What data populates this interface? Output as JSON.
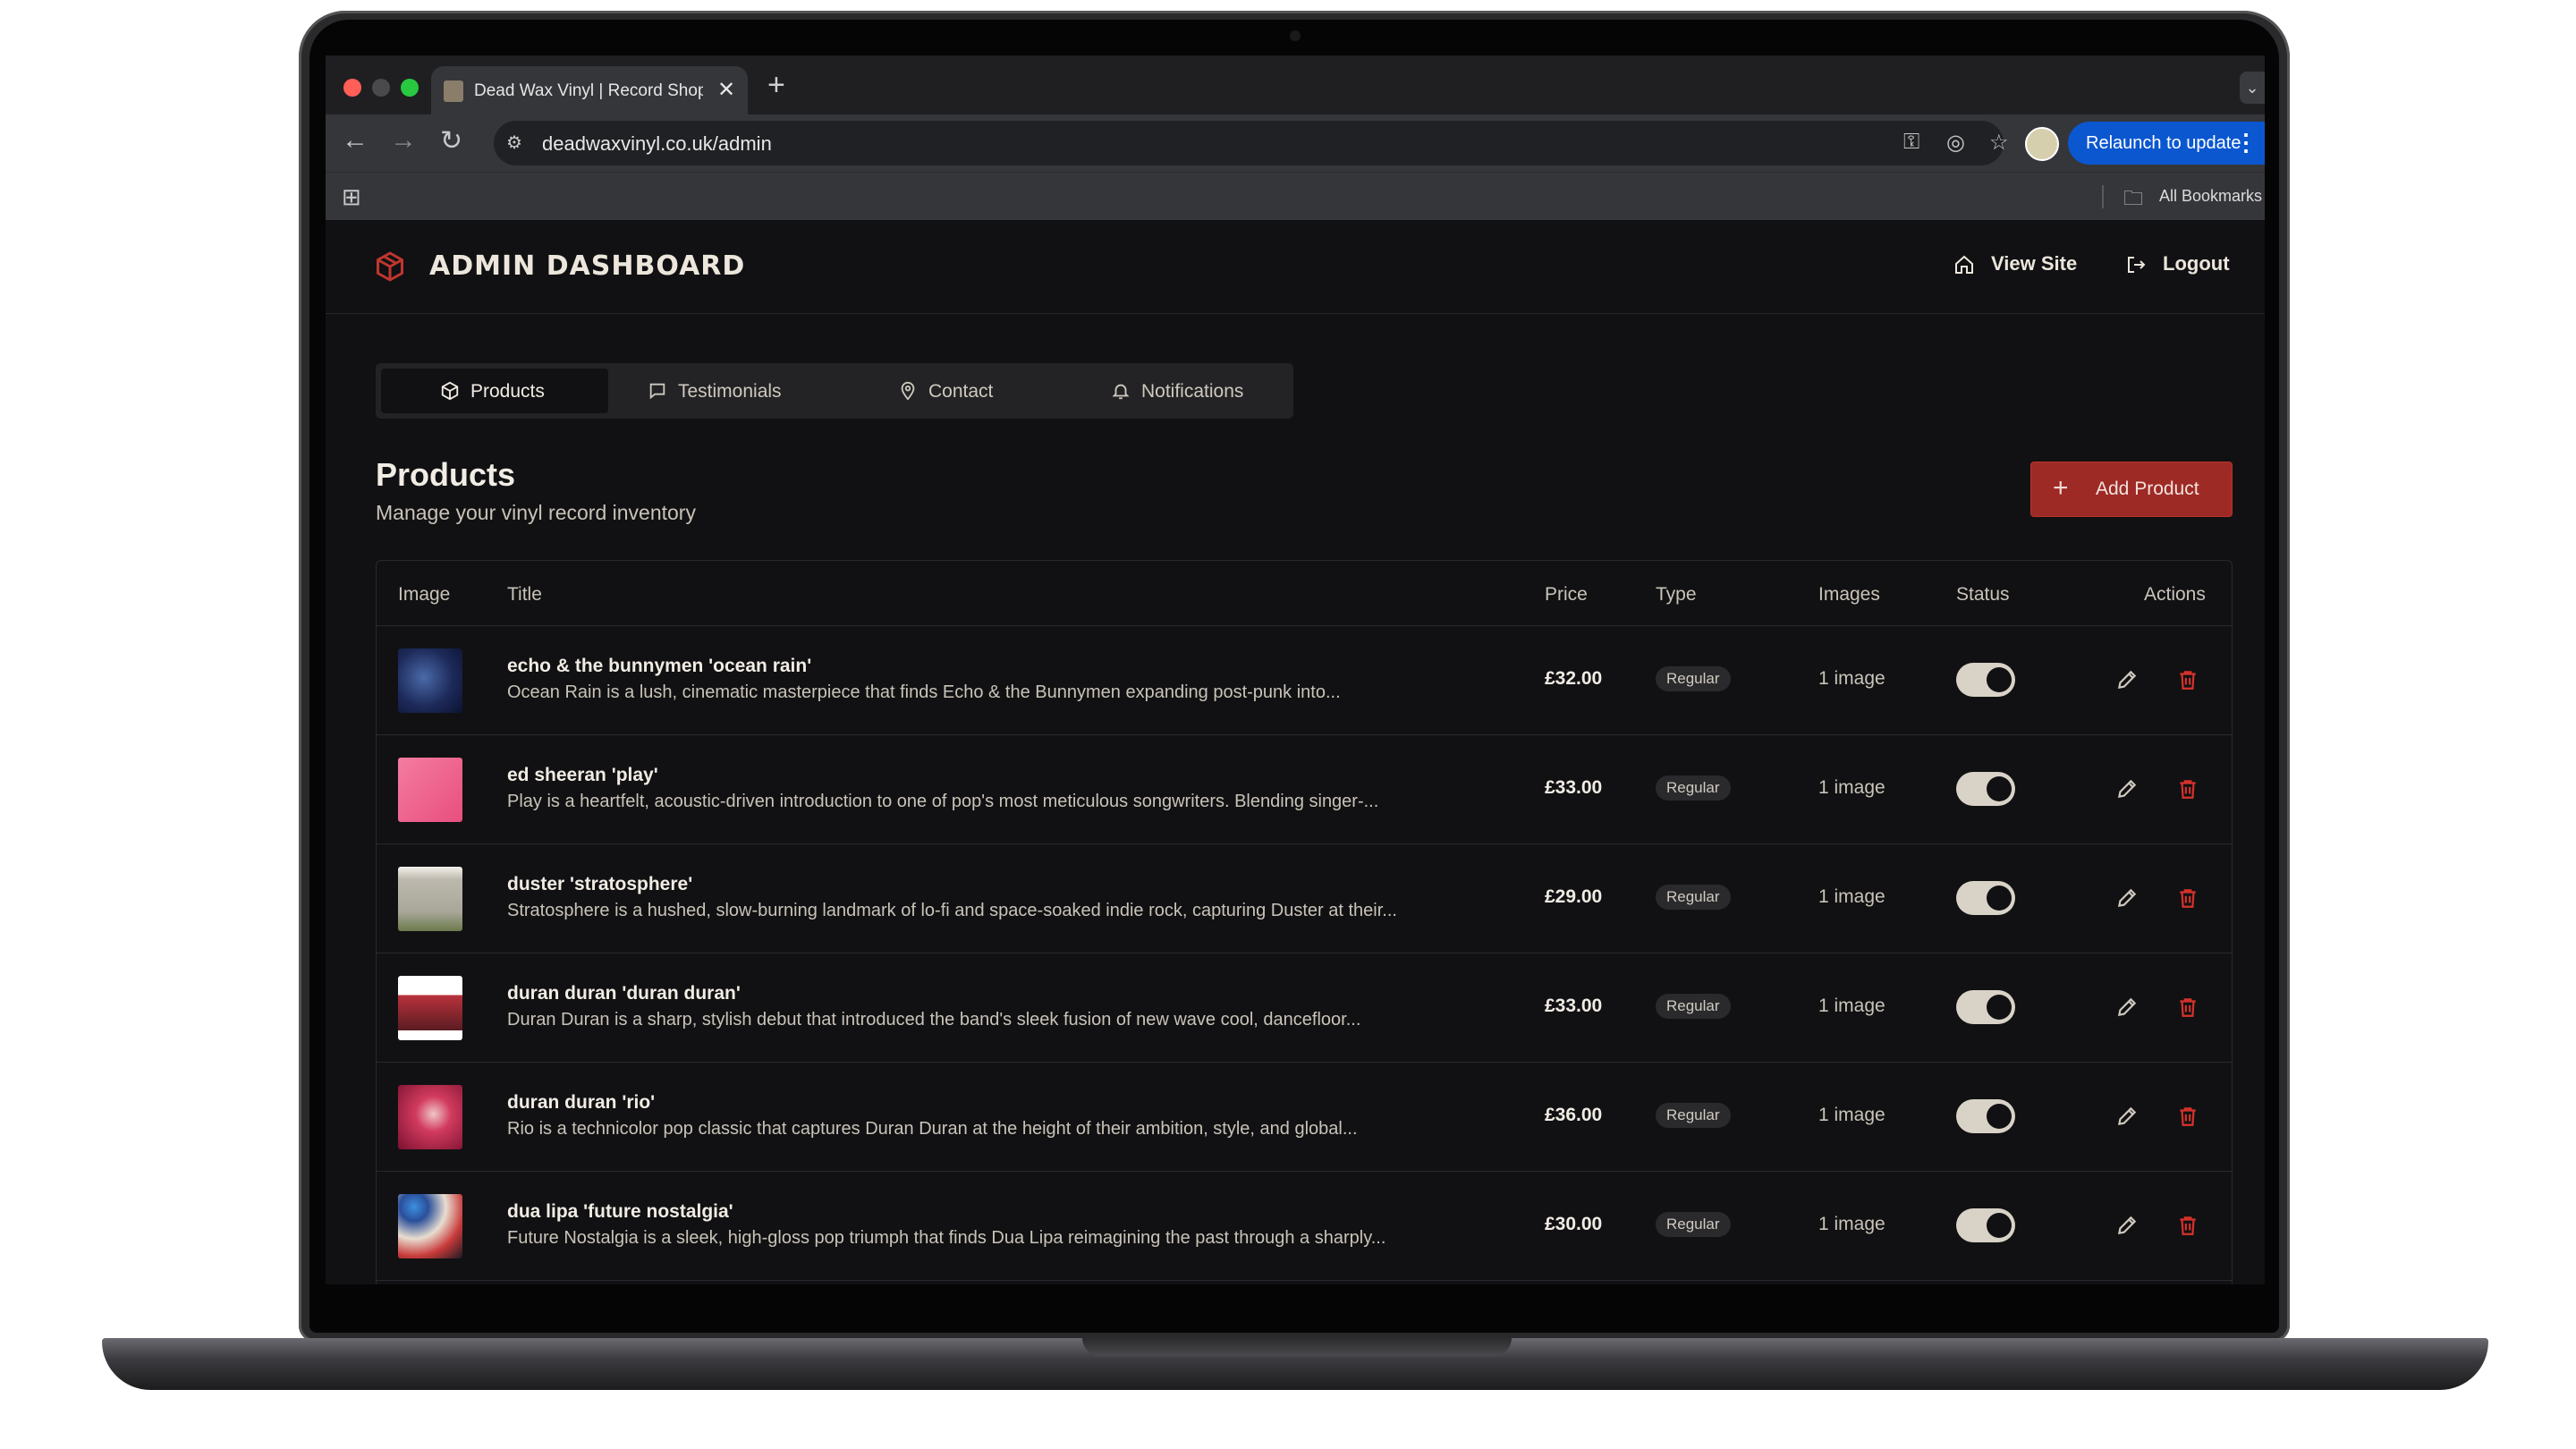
{
  "browser": {
    "tab_title": "Dead Wax Vinyl | Record Shop",
    "url": "deadwaxvinyl.co.uk/admin",
    "relaunch_label": "Relaunch to update",
    "bookmarks_label": "All Bookmarks"
  },
  "header": {
    "title": "ADMIN DASHBOARD",
    "view_site": "View Site",
    "logout": "Logout"
  },
  "tabs": [
    {
      "label": "Products",
      "icon": "package-icon",
      "active": true
    },
    {
      "label": "Testimonials",
      "icon": "message-icon",
      "active": false
    },
    {
      "label": "Contact",
      "icon": "map-pin-icon",
      "active": false
    },
    {
      "label": "Notifications",
      "icon": "bell-icon",
      "active": false
    }
  ],
  "section": {
    "title": "Products",
    "subtitle": "Manage your vinyl record inventory",
    "add_button": "Add Product"
  },
  "table": {
    "columns": [
      "Image",
      "Title",
      "Price",
      "Type",
      "Images",
      "Status",
      "Actions"
    ],
    "rows": [
      {
        "title": "echo & the bunnymen 'ocean rain'",
        "desc": "Ocean Rain is a lush, cinematic masterpiece that finds Echo & the Bunnymen expanding post-punk into...",
        "price": "£32.00",
        "type": "Regular",
        "images": "1 image",
        "active": true
      },
      {
        "title": "ed sheeran 'play'",
        "desc": "Play is a heartfelt, acoustic-driven introduction to one of pop's most meticulous songwriters. Blending singer-...",
        "price": "£33.00",
        "type": "Regular",
        "images": "1 image",
        "active": true
      },
      {
        "title": "duster 'stratosphere'",
        "desc": "Stratosphere is a hushed, slow-burning landmark of lo-fi and space-soaked indie rock, capturing Duster at their...",
        "price": "£29.00",
        "type": "Regular",
        "images": "1 image",
        "active": true
      },
      {
        "title": "duran duran 'duran duran'",
        "desc": "Duran Duran is a sharp, stylish debut that introduced the band's sleek fusion of new wave cool, dancefloor...",
        "price": "£33.00",
        "type": "Regular",
        "images": "1 image",
        "active": true
      },
      {
        "title": "duran duran 'rio'",
        "desc": "Rio is a technicolor pop classic that captures Duran Duran at the height of their ambition, style, and global...",
        "price": "£36.00",
        "type": "Regular",
        "images": "1 image",
        "active": true
      },
      {
        "title": "dua lipa 'future nostalgia'",
        "desc": "Future Nostalgia is a sleek, high-gloss pop triumph that finds Dua Lipa reimagining the past through a sharply...",
        "price": "£30.00",
        "type": "Regular",
        "images": "1 image",
        "active": true
      }
    ]
  },
  "colors": {
    "accent": "#9e2a25",
    "delete": "#d9322b",
    "background": "#111113",
    "text": "#f1ece4"
  }
}
